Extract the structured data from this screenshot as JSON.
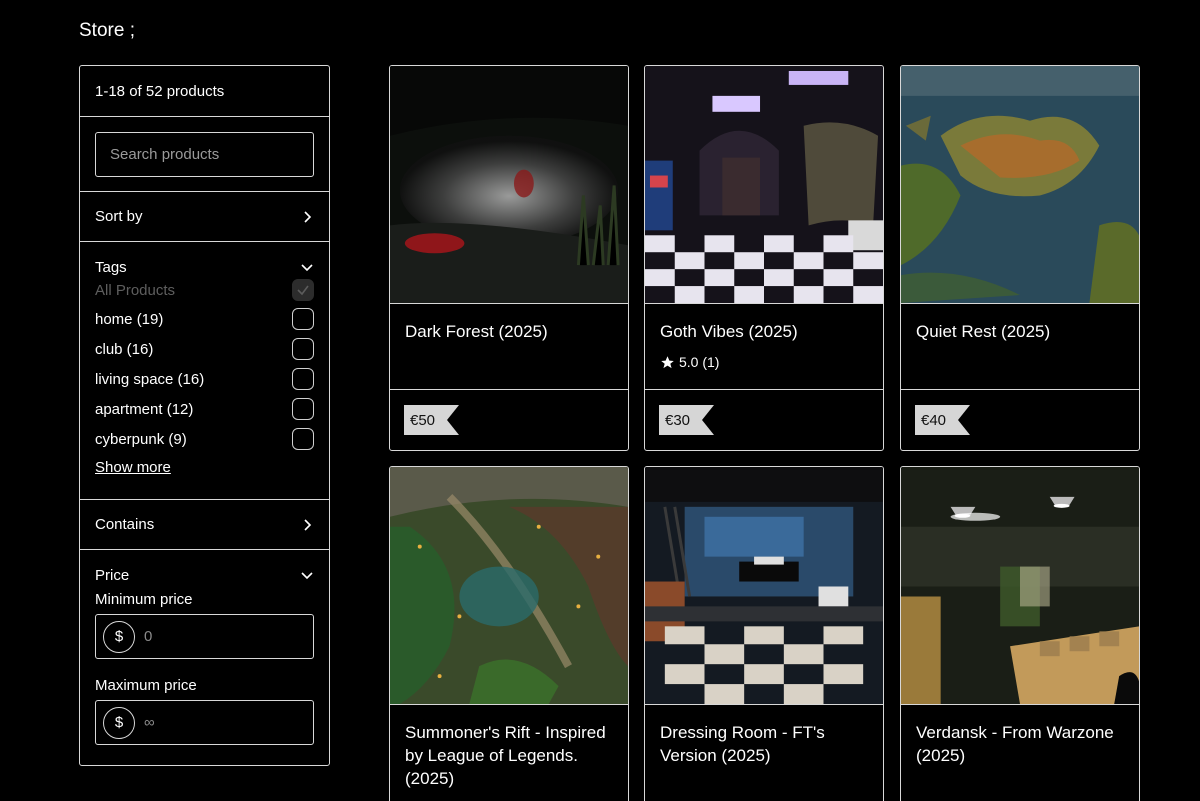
{
  "page": {
    "title": "Store ;"
  },
  "sidebar": {
    "count": "1-18 of 52 products",
    "search_placeholder": "Search products",
    "sort_label": "Sort by",
    "tags_label": "Tags",
    "tags": [
      {
        "label": "All Products",
        "checked": true,
        "disabled": true
      },
      {
        "label": "home (19)",
        "checked": false
      },
      {
        "label": "club (16)",
        "checked": false
      },
      {
        "label": "living space (16)",
        "checked": false
      },
      {
        "label": "apartment (12)",
        "checked": false
      },
      {
        "label": "cyberpunk (9)",
        "checked": false
      }
    ],
    "show_more": "Show more",
    "contains_label": "Contains",
    "price_label": "Price",
    "min_price_label": "Minimum price",
    "min_price_value": "0",
    "max_price_label": "Maximum price",
    "max_price_value": "∞",
    "currency_symbol": "$"
  },
  "products": [
    {
      "title": "Dark Forest (2025)",
      "price": "€50",
      "rating": "",
      "image": "dark-forest"
    },
    {
      "title": "Goth Vibes (2025)",
      "price": "€30",
      "rating": "5.0 (1)",
      "image": "goth-vibes"
    },
    {
      "title": "Quiet Rest (2025)",
      "price": "€40",
      "rating": "",
      "image": "quiet-rest"
    },
    {
      "title": "Summoner's Rift - Inspired by League of Legends. (2025)",
      "price": "",
      "rating": "",
      "image": "summoners-rift"
    },
    {
      "title": "Dressing Room - FT's Version (2025)",
      "price": "",
      "rating": "",
      "image": "dressing-room"
    },
    {
      "title": "Verdansk - From Warzone (2025)",
      "price": "",
      "rating": "",
      "image": "verdansk"
    }
  ],
  "colors": {
    "background": "#000000",
    "border": "#d8d8d8",
    "price_tag": "#d6d6d6"
  }
}
